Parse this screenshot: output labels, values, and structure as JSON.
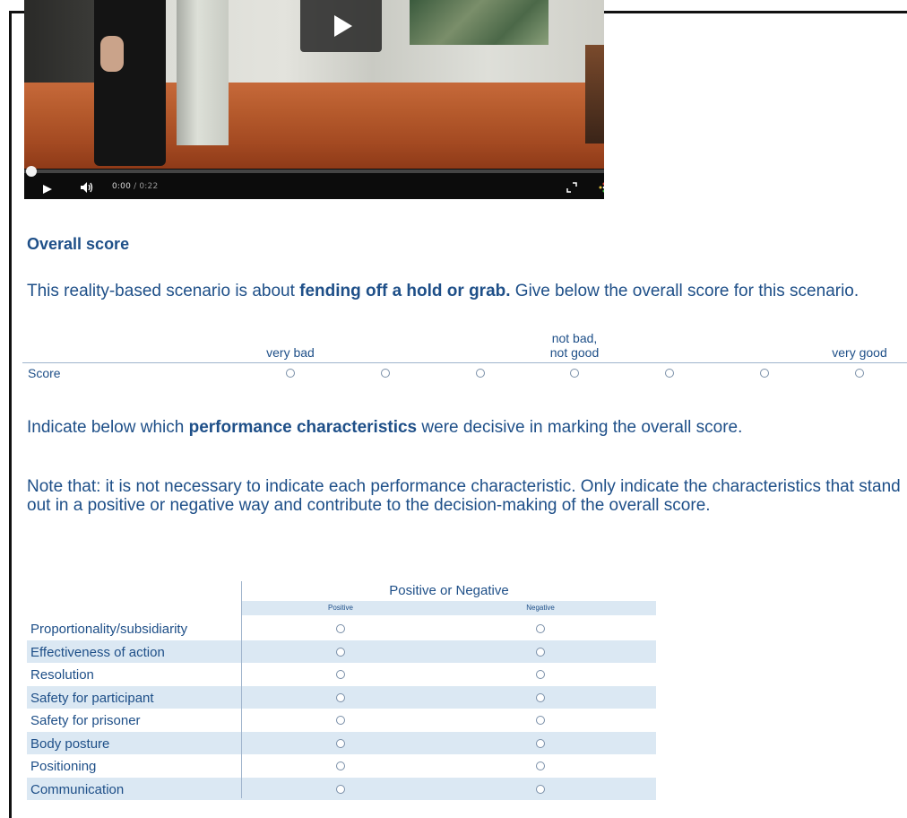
{
  "video": {
    "current_time": "0:00",
    "duration": "/ 0:22",
    "progress_fraction": 0.0
  },
  "overall_heading": "Overall score",
  "intro": {
    "before_bold": "This reality-based scenario is about ",
    "bold": "fending off a hold or grab.",
    "after_bold": " Give below the overall score for this scenario."
  },
  "score_scale": {
    "label_low": "very bad",
    "label_mid_line1": "not bad,",
    "label_mid_line2": "not good",
    "label_high": "very good",
    "row_label": "Score",
    "option_count": 7
  },
  "indicate": {
    "before_bold": "Indicate below which ",
    "bold": "performance characteristics",
    "after_bold": "  were decisive in marking the overall score."
  },
  "note": "Note that: it is not necessary to indicate each performance characteristic. Only indicate the characteristics that stand out in a positive or negative way and contribute to the decision-making of the overall score.",
  "characteristics_table": {
    "group_header": "Positive or Negative",
    "col_positive": "Positive",
    "col_negative": "Negative",
    "rows": [
      "Proportionality/subsidiarity",
      "Effectiveness of action",
      "Resolution",
      "Safety for participant",
      "Safety for prisoner",
      "Body posture",
      "Positioning",
      "Communication"
    ]
  }
}
